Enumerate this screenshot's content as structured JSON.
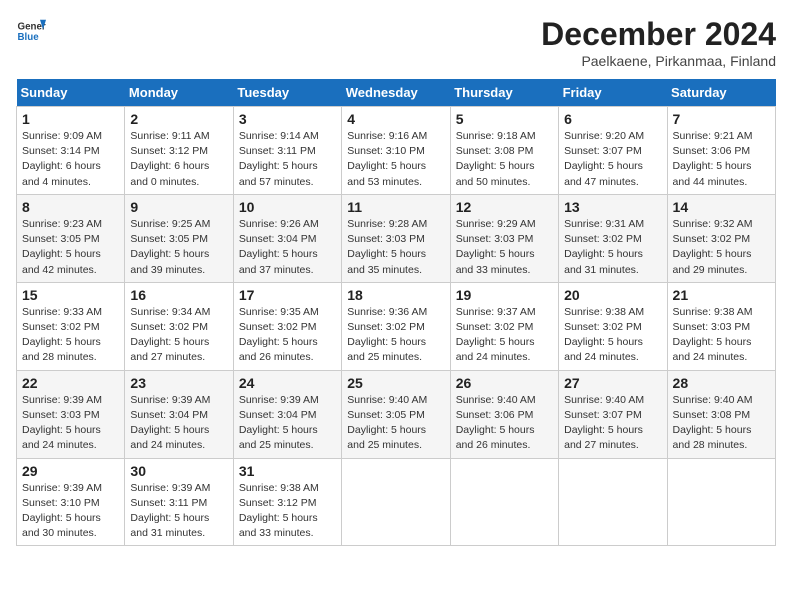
{
  "logo": {
    "general": "General",
    "blue": "Blue"
  },
  "header": {
    "month": "December 2024",
    "location": "Paelkaene, Pirkanmaa, Finland"
  },
  "weekdays": [
    "Sunday",
    "Monday",
    "Tuesday",
    "Wednesday",
    "Thursday",
    "Friday",
    "Saturday"
  ],
  "weeks": [
    [
      {
        "day": "1",
        "sunrise": "9:09 AM",
        "sunset": "3:14 PM",
        "daylight": "6 hours and 4 minutes."
      },
      {
        "day": "2",
        "sunrise": "9:11 AM",
        "sunset": "3:12 PM",
        "daylight": "6 hours and 0 minutes."
      },
      {
        "day": "3",
        "sunrise": "9:14 AM",
        "sunset": "3:11 PM",
        "daylight": "5 hours and 57 minutes."
      },
      {
        "day": "4",
        "sunrise": "9:16 AM",
        "sunset": "3:10 PM",
        "daylight": "5 hours and 53 minutes."
      },
      {
        "day": "5",
        "sunrise": "9:18 AM",
        "sunset": "3:08 PM",
        "daylight": "5 hours and 50 minutes."
      },
      {
        "day": "6",
        "sunrise": "9:20 AM",
        "sunset": "3:07 PM",
        "daylight": "5 hours and 47 minutes."
      },
      {
        "day": "7",
        "sunrise": "9:21 AM",
        "sunset": "3:06 PM",
        "daylight": "5 hours and 44 minutes."
      }
    ],
    [
      {
        "day": "8",
        "sunrise": "9:23 AM",
        "sunset": "3:05 PM",
        "daylight": "5 hours and 42 minutes."
      },
      {
        "day": "9",
        "sunrise": "9:25 AM",
        "sunset": "3:05 PM",
        "daylight": "5 hours and 39 minutes."
      },
      {
        "day": "10",
        "sunrise": "9:26 AM",
        "sunset": "3:04 PM",
        "daylight": "5 hours and 37 minutes."
      },
      {
        "day": "11",
        "sunrise": "9:28 AM",
        "sunset": "3:03 PM",
        "daylight": "5 hours and 35 minutes."
      },
      {
        "day": "12",
        "sunrise": "9:29 AM",
        "sunset": "3:03 PM",
        "daylight": "5 hours and 33 minutes."
      },
      {
        "day": "13",
        "sunrise": "9:31 AM",
        "sunset": "3:02 PM",
        "daylight": "5 hours and 31 minutes."
      },
      {
        "day": "14",
        "sunrise": "9:32 AM",
        "sunset": "3:02 PM",
        "daylight": "5 hours and 29 minutes."
      }
    ],
    [
      {
        "day": "15",
        "sunrise": "9:33 AM",
        "sunset": "3:02 PM",
        "daylight": "5 hours and 28 minutes."
      },
      {
        "day": "16",
        "sunrise": "9:34 AM",
        "sunset": "3:02 PM",
        "daylight": "5 hours and 27 minutes."
      },
      {
        "day": "17",
        "sunrise": "9:35 AM",
        "sunset": "3:02 PM",
        "daylight": "5 hours and 26 minutes."
      },
      {
        "day": "18",
        "sunrise": "9:36 AM",
        "sunset": "3:02 PM",
        "daylight": "5 hours and 25 minutes."
      },
      {
        "day": "19",
        "sunrise": "9:37 AM",
        "sunset": "3:02 PM",
        "daylight": "5 hours and 24 minutes."
      },
      {
        "day": "20",
        "sunrise": "9:38 AM",
        "sunset": "3:02 PM",
        "daylight": "5 hours and 24 minutes."
      },
      {
        "day": "21",
        "sunrise": "9:38 AM",
        "sunset": "3:03 PM",
        "daylight": "5 hours and 24 minutes."
      }
    ],
    [
      {
        "day": "22",
        "sunrise": "9:39 AM",
        "sunset": "3:03 PM",
        "daylight": "5 hours and 24 minutes."
      },
      {
        "day": "23",
        "sunrise": "9:39 AM",
        "sunset": "3:04 PM",
        "daylight": "5 hours and 24 minutes."
      },
      {
        "day": "24",
        "sunrise": "9:39 AM",
        "sunset": "3:04 PM",
        "daylight": "5 hours and 25 minutes."
      },
      {
        "day": "25",
        "sunrise": "9:40 AM",
        "sunset": "3:05 PM",
        "daylight": "5 hours and 25 minutes."
      },
      {
        "day": "26",
        "sunrise": "9:40 AM",
        "sunset": "3:06 PM",
        "daylight": "5 hours and 26 minutes."
      },
      {
        "day": "27",
        "sunrise": "9:40 AM",
        "sunset": "3:07 PM",
        "daylight": "5 hours and 27 minutes."
      },
      {
        "day": "28",
        "sunrise": "9:40 AM",
        "sunset": "3:08 PM",
        "daylight": "5 hours and 28 minutes."
      }
    ],
    [
      {
        "day": "29",
        "sunrise": "9:39 AM",
        "sunset": "3:10 PM",
        "daylight": "5 hours and 30 minutes."
      },
      {
        "day": "30",
        "sunrise": "9:39 AM",
        "sunset": "3:11 PM",
        "daylight": "5 hours and 31 minutes."
      },
      {
        "day": "31",
        "sunrise": "9:38 AM",
        "sunset": "3:12 PM",
        "daylight": "5 hours and 33 minutes."
      },
      null,
      null,
      null,
      null
    ]
  ]
}
